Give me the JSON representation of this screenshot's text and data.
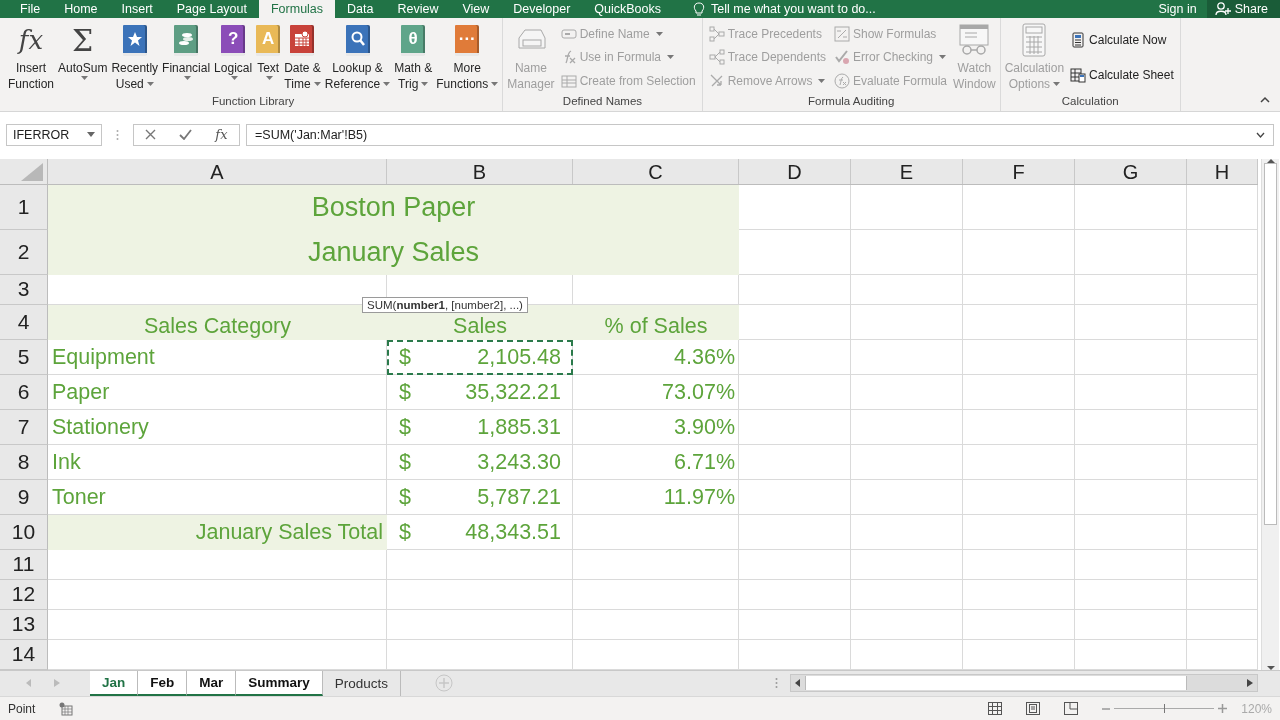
{
  "menu_tabs": [
    {
      "label": "File",
      "selected": false
    },
    {
      "label": "Home",
      "selected": false
    },
    {
      "label": "Insert",
      "selected": false
    },
    {
      "label": "Page Layout",
      "selected": false
    },
    {
      "label": "Formulas",
      "selected": true
    },
    {
      "label": "Data",
      "selected": false
    },
    {
      "label": "Review",
      "selected": false
    },
    {
      "label": "View",
      "selected": false
    },
    {
      "label": "Developer",
      "selected": false
    },
    {
      "label": "QuickBooks",
      "selected": false
    }
  ],
  "tell_me": "Tell me what you want to do...",
  "sign_in": "Sign in",
  "share": "Share",
  "ribbon_groups": [
    {
      "label": "Function Library",
      "items": [
        {
          "kind": "glyph",
          "glyph": "fx",
          "label_lines": [
            "Insert",
            "Function"
          ],
          "dropdown": false,
          "disabled": false
        },
        {
          "kind": "glyph",
          "glyph": "Σ",
          "label_lines": [
            "AutoSum"
          ],
          "dropdown": true,
          "disabled": false
        },
        {
          "kind": "star-book",
          "color": "#3b73b9",
          "label_lines": [
            "Recently",
            "Used"
          ],
          "dropdown": true,
          "disabled": false
        },
        {
          "kind": "coins-book",
          "color": "#5e9e84",
          "label_lines": [
            "Financial"
          ],
          "dropdown": true,
          "disabled": false
        },
        {
          "kind": "glyph-book",
          "color": "#8b4db8",
          "glyph": "?",
          "label_lines": [
            "Logical"
          ],
          "dropdown": true,
          "disabled": false
        },
        {
          "kind": "glyph-book",
          "color": "#e9b957",
          "glyph": "A",
          "label_lines": [
            "Text"
          ],
          "dropdown": true,
          "disabled": false
        },
        {
          "kind": "calendar-book",
          "color": "#c8423a",
          "label_lines": [
            "Date &",
            "Time"
          ],
          "dropdown": true,
          "disabled": false
        },
        {
          "kind": "magnifier-book",
          "color": "#3b73b9",
          "label_lines": [
            "Lookup &",
            "Reference"
          ],
          "dropdown": true,
          "disabled": false
        },
        {
          "kind": "glyph-book",
          "color": "#5fa58a",
          "glyph": "θ",
          "label_lines": [
            "Math &",
            "Trig"
          ],
          "dropdown": true,
          "disabled": false
        },
        {
          "kind": "glyph-book",
          "color": "#e07b39",
          "glyph": "···",
          "label_lines": [
            "More",
            "Functions"
          ],
          "dropdown": true,
          "disabled": false
        }
      ]
    },
    {
      "label": "Defined Names",
      "items": [
        {
          "kind": "name-manager",
          "label_lines": [
            "Name",
            "Manager"
          ],
          "dropdown": false,
          "disabled": true
        },
        {
          "kind": "stack",
          "items": [
            {
              "kind": "tag",
              "label": "Define Name",
              "dropdown": true,
              "disabled": true
            },
            {
              "kind": "fx-small",
              "label": "Use in Formula",
              "dropdown": true,
              "disabled": true
            },
            {
              "kind": "table",
              "label": "Create from Selection",
              "dropdown": false,
              "disabled": true
            }
          ]
        }
      ]
    },
    {
      "label": "Formula Auditing",
      "items": [
        {
          "kind": "stack",
          "items": [
            {
              "kind": "precedents",
              "label": "Trace Precedents",
              "dropdown": false,
              "disabled": true
            },
            {
              "kind": "dependents",
              "label": "Trace Dependents",
              "dropdown": false,
              "disabled": true
            },
            {
              "kind": "remove-arrows",
              "label": "Remove Arrows",
              "dropdown": true,
              "disabled": true
            }
          ]
        },
        {
          "kind": "stack",
          "items": [
            {
              "kind": "show-formulas",
              "label": "Show Formulas",
              "dropdown": false,
              "disabled": true
            },
            {
              "kind": "error-check",
              "label": "Error Checking",
              "dropdown": true,
              "disabled": true
            },
            {
              "kind": "evaluate",
              "label": "Evaluate Formula",
              "dropdown": false,
              "disabled": true
            }
          ]
        },
        {
          "kind": "watch-window",
          "label_lines": [
            "Watch",
            "Window"
          ],
          "dropdown": false,
          "disabled": true
        }
      ]
    },
    {
      "label": "Calculation",
      "items": [
        {
          "kind": "calculator",
          "label_lines": [
            "Calculation",
            "Options"
          ],
          "dropdown": true,
          "disabled": true
        },
        {
          "kind": "stack",
          "items": [
            {
              "kind": "calculator",
              "label": "Calculate Now",
              "dropdown": false,
              "disabled": false
            },
            {
              "kind": "calc-sheet",
              "label": "Calculate Sheet",
              "dropdown": false,
              "disabled": false
            }
          ]
        }
      ]
    }
  ],
  "formula_bar": {
    "name_box": "IFERROR",
    "function_glyph": "fx",
    "formula": "=SUM('Jan:Mar'!B5)"
  },
  "columns": [
    "A",
    "B",
    "C",
    "D",
    "E",
    "F",
    "G",
    "H"
  ],
  "rows": [
    {
      "number": "1",
      "cells": [
        {
          "kind": "title",
          "text": "Boston Paper",
          "merged": true,
          "shaded": true
        }
      ]
    },
    {
      "number": "2",
      "cells": [
        {
          "kind": "title",
          "text": "January Sales",
          "merged": true,
          "shaded": true
        }
      ]
    },
    {
      "number": "3",
      "cells": []
    },
    {
      "number": "4",
      "cells": [
        {
          "kind": "header",
          "text": "Sales Category",
          "merged": false,
          "shaded": true
        },
        {
          "kind": "header",
          "text": "Sales",
          "merged": false,
          "shaded": true
        },
        {
          "kind": "header",
          "text": "% of Sales",
          "merged": false,
          "shaded": true
        }
      ]
    },
    {
      "number": "5",
      "cells": [
        {
          "kind": "label",
          "text": "Equipment",
          "merged": false,
          "shaded": false
        },
        {
          "kind": "currency",
          "symbol": "$",
          "text": "2,105.48",
          "merged": false,
          "shaded": false,
          "copied": true
        },
        {
          "kind": "percent",
          "text": "4.36%",
          "merged": false,
          "shaded": false
        }
      ]
    },
    {
      "number": "6",
      "cells": [
        {
          "kind": "label",
          "text": "Paper",
          "merged": false,
          "shaded": false
        },
        {
          "kind": "currency",
          "symbol": "$",
          "text": "35,322.21",
          "merged": false,
          "shaded": false,
          "copied": false
        },
        {
          "kind": "percent",
          "text": "73.07%",
          "merged": false,
          "shaded": false
        }
      ]
    },
    {
      "number": "7",
      "cells": [
        {
          "kind": "label",
          "text": "Stationery",
          "merged": false,
          "shaded": false
        },
        {
          "kind": "currency",
          "symbol": "$",
          "text": "1,885.31",
          "merged": false,
          "shaded": false,
          "copied": false
        },
        {
          "kind": "percent",
          "text": "3.90%",
          "merged": false,
          "shaded": false
        }
      ]
    },
    {
      "number": "8",
      "cells": [
        {
          "kind": "label",
          "text": "Ink",
          "merged": false,
          "shaded": false
        },
        {
          "kind": "currency",
          "symbol": "$",
          "text": "3,243.30",
          "merged": false,
          "shaded": false,
          "copied": false
        },
        {
          "kind": "percent",
          "text": "6.71%",
          "merged": false,
          "shaded": false
        }
      ]
    },
    {
      "number": "9",
      "cells": [
        {
          "kind": "label",
          "text": "Toner",
          "merged": false,
          "shaded": false
        },
        {
          "kind": "currency",
          "symbol": "$",
          "text": "5,787.21",
          "merged": false,
          "shaded": false,
          "copied": false
        },
        {
          "kind": "percent",
          "text": "11.97%",
          "merged": false,
          "shaded": false
        }
      ]
    },
    {
      "number": "10",
      "cells": [
        {
          "kind": "total",
          "text": "January Sales Total",
          "merged": false,
          "shaded": true
        },
        {
          "kind": "currency",
          "symbol": "$",
          "text": "48,343.51",
          "merged": false,
          "shaded": false,
          "copied": false
        }
      ]
    },
    {
      "number": "11",
      "cells": []
    },
    {
      "number": "12",
      "cells": []
    },
    {
      "number": "13",
      "cells": []
    },
    {
      "number": "14",
      "cells": []
    }
  ],
  "tooltip": "SUM(**number1**, [number2], ...)",
  "sheet_tabs": [
    {
      "label": "Jan",
      "selected": true,
      "grouped": true
    },
    {
      "label": "Feb",
      "selected": false,
      "grouped": true
    },
    {
      "label": "Mar",
      "selected": false,
      "grouped": true
    },
    {
      "label": "Summary",
      "selected": false,
      "grouped": true
    },
    {
      "label": "Products",
      "selected": false,
      "grouped": false
    }
  ],
  "status_bar": {
    "mode": "Point",
    "zoom_slider": {
      "level": 0.5
    },
    "zoom": "120%"
  }
}
